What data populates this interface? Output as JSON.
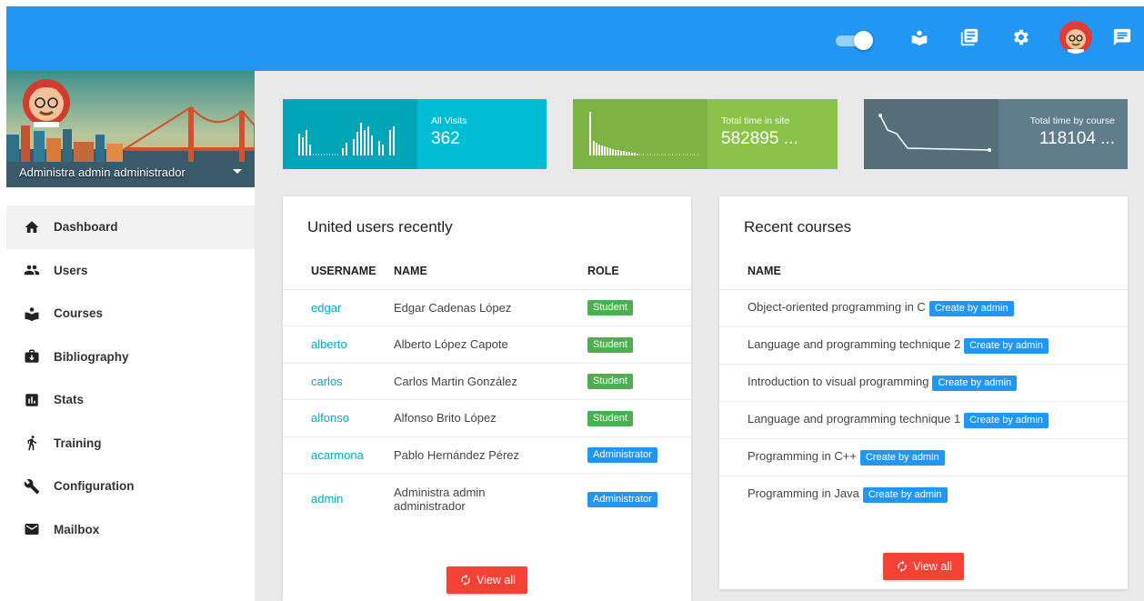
{
  "topbar": {
    "color": "#2196f3",
    "icons": [
      "toggle-switch",
      "courses-icon",
      "library-icon",
      "settings-icon",
      "user-avatar",
      "chat-icon"
    ]
  },
  "sidebar": {
    "profile_name": "Administra admin administrador",
    "items": [
      {
        "label": "Dashboard",
        "icon": "home-icon",
        "active": true
      },
      {
        "label": "Users",
        "icon": "users-icon",
        "active": false
      },
      {
        "label": "Courses",
        "icon": "courses-icon",
        "active": false
      },
      {
        "label": "Bibliography",
        "icon": "briefcase-icon",
        "active": false
      },
      {
        "label": "Stats",
        "icon": "stats-icon",
        "active": false
      },
      {
        "label": "Training",
        "icon": "run-icon",
        "active": false
      },
      {
        "label": "Configuration",
        "icon": "wrench-icon",
        "active": false
      },
      {
        "label": "Mailbox",
        "icon": "mail-icon",
        "active": false
      }
    ]
  },
  "stats": [
    {
      "label": "All Visits",
      "value": "362",
      "color": "#00bcd4"
    },
    {
      "label": "Total time in site",
      "value": "582895 ...",
      "color": "#8bc34a"
    },
    {
      "label": "Total time by course",
      "value": "118104 ...",
      "color": "#607d8b"
    }
  ],
  "users_card": {
    "title": "United users recently",
    "headers": [
      "USERNAME",
      "NAME",
      "ROLE"
    ],
    "rows": [
      {
        "username": "edgar",
        "name": "Edgar Cadenas López",
        "role": "Student",
        "role_type": "student"
      },
      {
        "username": "alberto",
        "name": "Alberto López Capote",
        "role": "Student",
        "role_type": "student"
      },
      {
        "username": "carlos",
        "name": "Carlos Martin González",
        "role": "Student",
        "role_type": "student"
      },
      {
        "username": "alfonso",
        "name": "Alfonso Brito López",
        "role": "Student",
        "role_type": "student"
      },
      {
        "username": "acarmona",
        "name": "Pablo Hernández Pérez",
        "role": "Administrator",
        "role_type": "admin"
      },
      {
        "username": "admin",
        "name": "Administra admin administrador",
        "role": "Administrator",
        "role_type": "admin"
      }
    ],
    "view_all": "View all"
  },
  "courses_card": {
    "title": "Recent courses",
    "header": "NAME",
    "rows": [
      {
        "name": "Object-oriented programming in C",
        "badge": "Create by admin"
      },
      {
        "name": "Language and programming technique 2",
        "badge": "Create by admin"
      },
      {
        "name": "Introduction to visual programming",
        "badge": "Create by admin"
      },
      {
        "name": "Language and programming technique 1",
        "badge": "Create by admin"
      },
      {
        "name": "Programming in C++",
        "badge": "Create by admin"
      },
      {
        "name": "Programming in Java",
        "badge": "Create by admin"
      }
    ],
    "view_all": "View all"
  }
}
